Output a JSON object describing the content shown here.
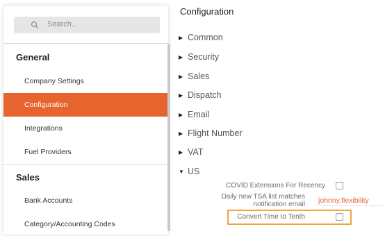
{
  "search": {
    "placeholder": "Search..."
  },
  "sidebar": {
    "groups": [
      {
        "heading": "General",
        "items": [
          "Company Settings",
          "Configuration",
          "Integrations",
          "Fuel Providers"
        ]
      },
      {
        "heading": "Sales",
        "items": [
          "Bank Accounts",
          "Category/Accounting Codes"
        ]
      }
    ],
    "active_item": "Configuration"
  },
  "main": {
    "title": "Configuration",
    "sections": [
      "Common",
      "Security",
      "Sales",
      "Dispatch",
      "Email",
      "Flight Number",
      "VAT",
      "US"
    ],
    "expanded_section": "US",
    "settings": [
      {
        "label": "COVID Extensions For Recency",
        "checked": false
      },
      {
        "label_line1": "Daily new TSA list matches",
        "label_line2": "notification email",
        "value": "johnny.flexibility"
      },
      {
        "label": "Convert Time to Tenth",
        "checked": false
      }
    ]
  },
  "colors": {
    "accent": "#e8642f",
    "highlight": "#f0a43a"
  },
  "icons": {
    "search": "search-icon",
    "collapsed": "caret-right-icon",
    "expanded": "caret-down-icon"
  }
}
